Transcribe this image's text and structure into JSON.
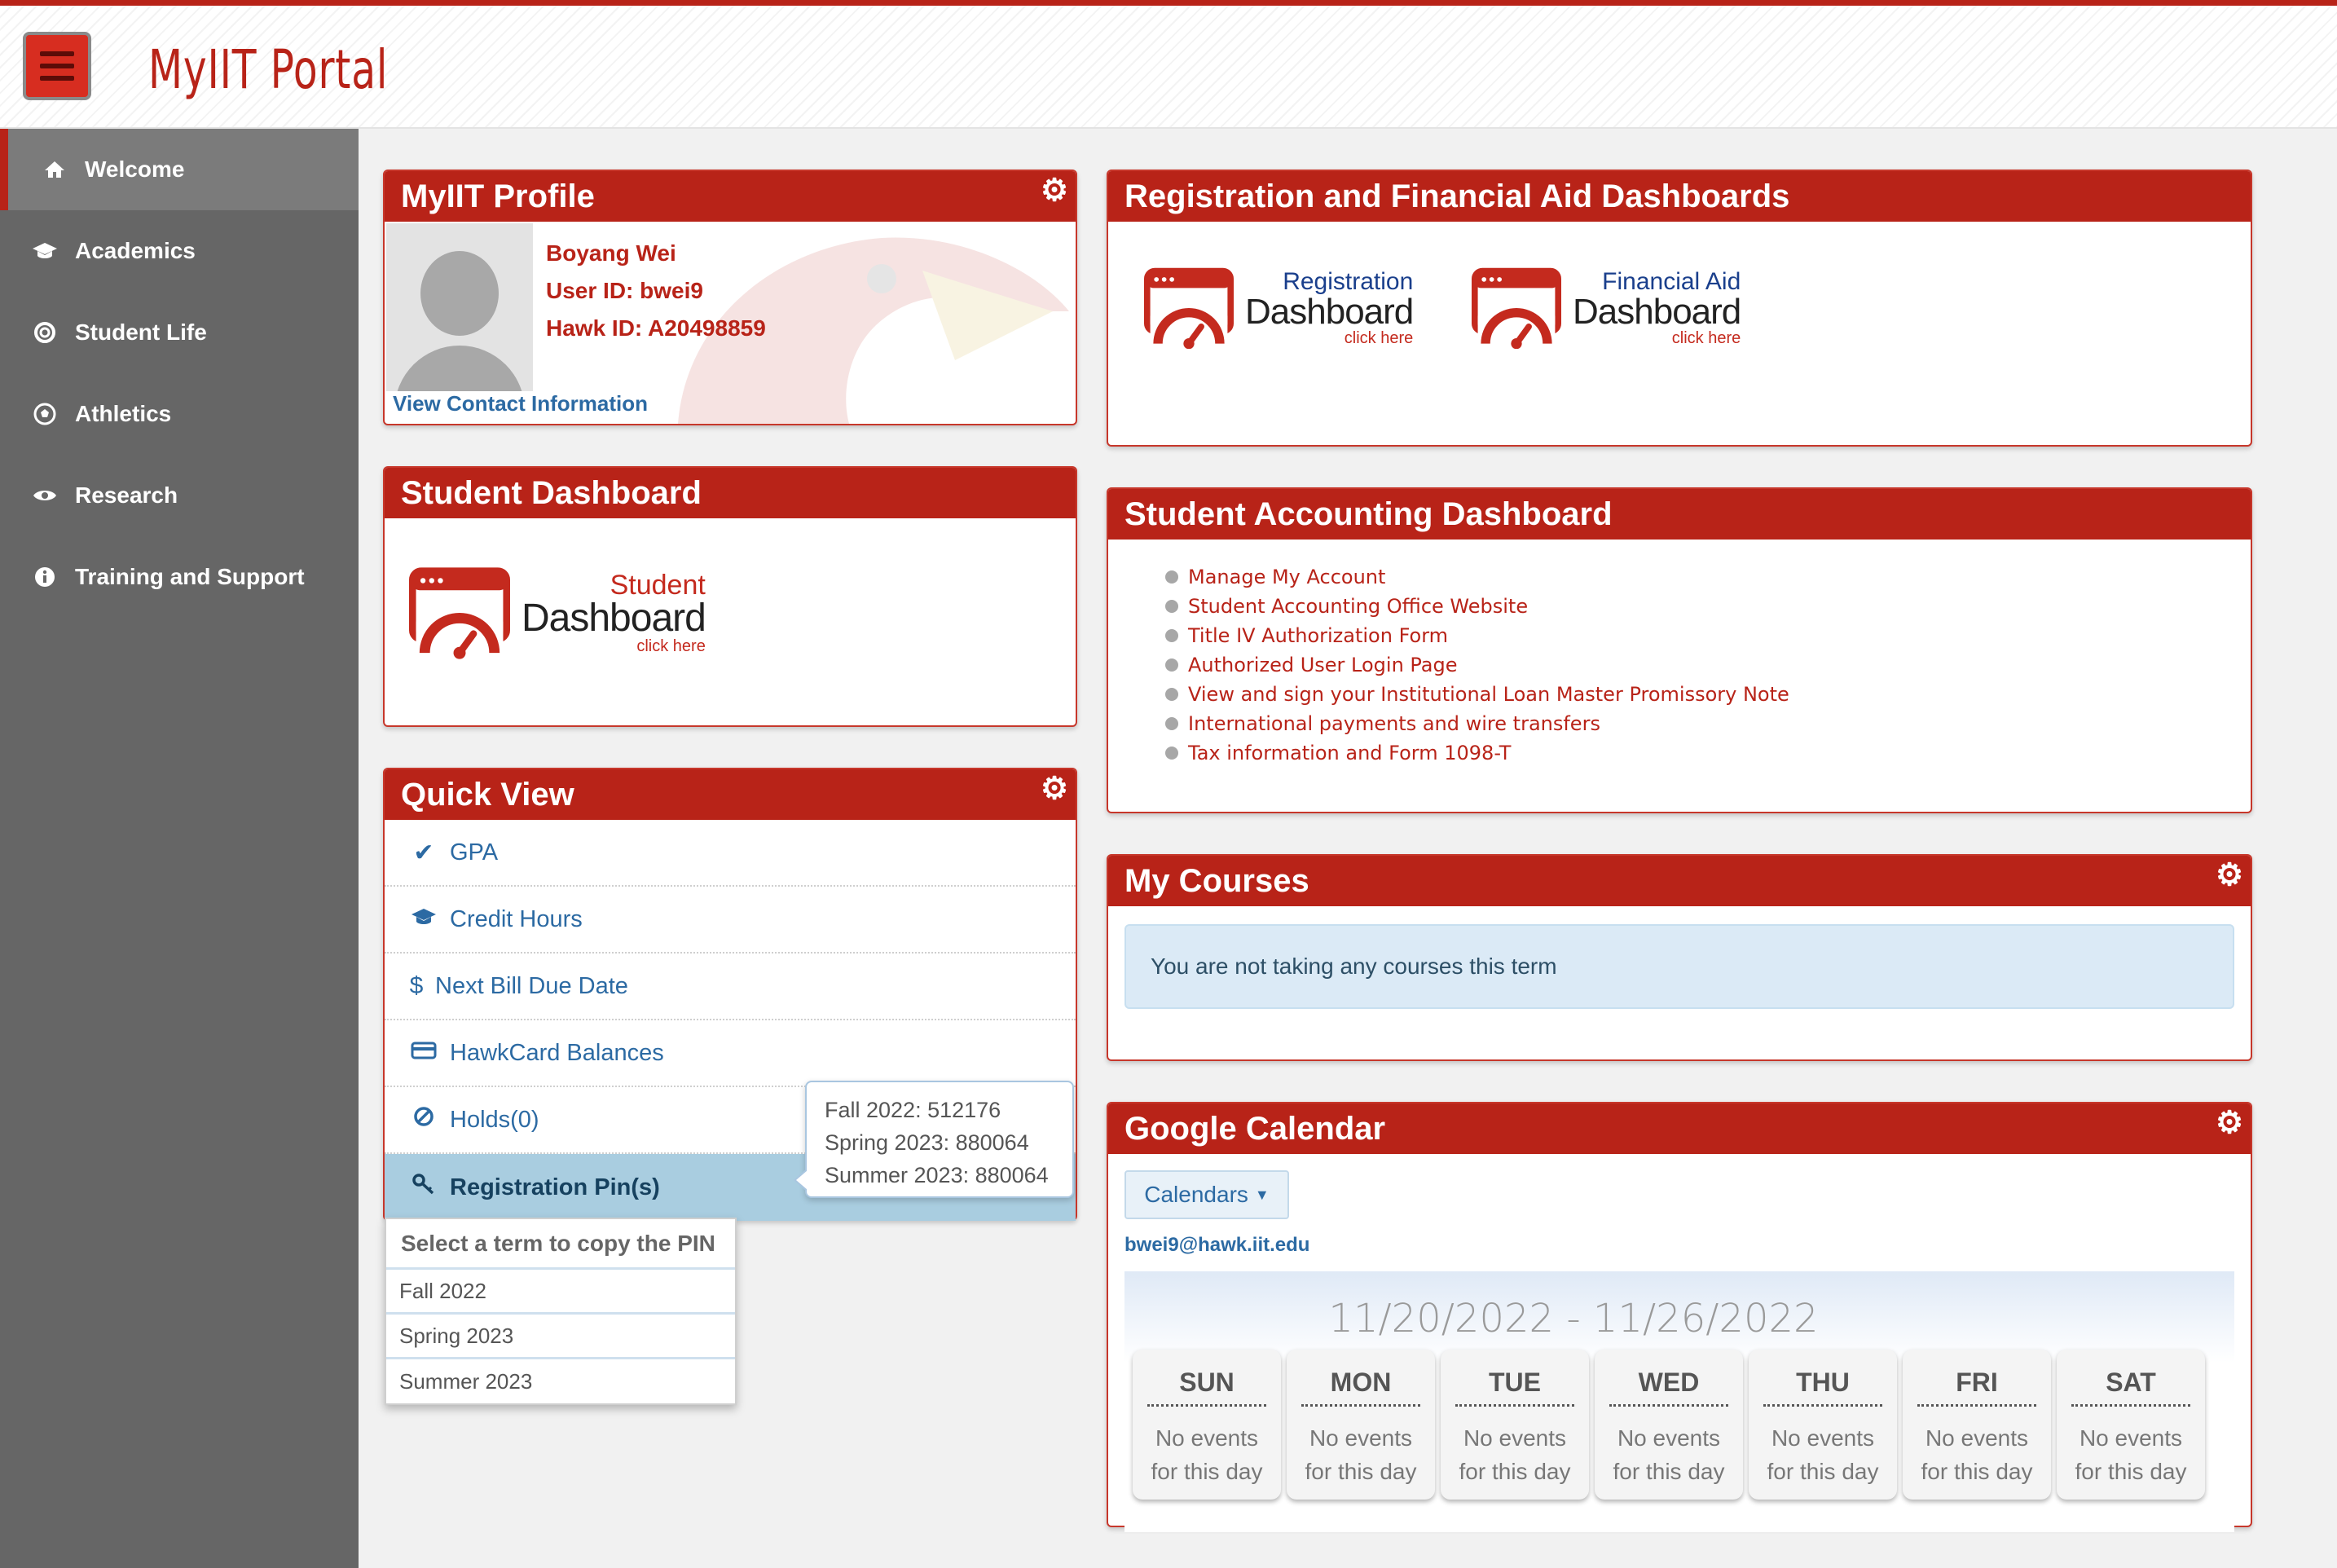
{
  "header": {
    "brand": "MyIIT Portal"
  },
  "sidebar": {
    "items": [
      {
        "label": "Welcome",
        "icon": "home-icon"
      },
      {
        "label": "Academics",
        "icon": "graduation-cap-icon"
      },
      {
        "label": "Student Life",
        "icon": "life-ring-icon"
      },
      {
        "label": "Athletics",
        "icon": "soccer-ball-icon"
      },
      {
        "label": "Research",
        "icon": "eye-icon"
      },
      {
        "label": "Training and Support",
        "icon": "info-icon"
      }
    ]
  },
  "profile": {
    "title": "MyIIT Profile",
    "name": "Boyang Wei",
    "user_id": "User ID: bwei9",
    "hawk_id": "Hawk ID: A20498859",
    "contact_link": "View Contact Information"
  },
  "student_dashboard": {
    "title": "Student Dashboard",
    "logo_top": "Student",
    "logo_main": "Dashboard",
    "logo_sub": "click here"
  },
  "quick_view": {
    "title": "Quick View",
    "items": [
      {
        "label": "GPA",
        "icon": "check-icon"
      },
      {
        "label": "Credit Hours",
        "icon": "graduation-cap-icon"
      },
      {
        "label": "Next Bill Due Date",
        "icon": "dollar-icon"
      },
      {
        "label": "HawkCard Balances",
        "icon": "credit-card-icon"
      },
      {
        "label": "Holds(0)",
        "icon": "ban-icon"
      },
      {
        "label": "Registration Pin(s)",
        "icon": "key-icon"
      }
    ],
    "pins_popover": [
      "Fall 2022: 512176",
      "Spring 2023: 880064",
      "Summer 2023: 880064"
    ],
    "term_menu": {
      "header": "Select a term to copy the PIN",
      "options": [
        "Fall 2022",
        "Spring 2023",
        "Summer 2023"
      ]
    }
  },
  "reg_fin": {
    "title": "Registration and Financial Aid Dashboards",
    "registration": {
      "top": "Registration",
      "main": "Dashboard",
      "sub": "click here"
    },
    "financial": {
      "top": "Financial Aid",
      "main": "Dashboard",
      "sub": "click here"
    }
  },
  "accounting": {
    "title": "Student Accounting Dashboard",
    "links": [
      "Manage My Account",
      "Student Accounting Office Website",
      "Title IV Authorization Form",
      "Authorized User Login Page",
      "View and sign your Institutional Loan Master Promissory Note",
      "International payments and wire transfers",
      "Tax information and Form 1098-T"
    ]
  },
  "courses": {
    "title": "My Courses",
    "message": "You are not taking any courses this term"
  },
  "calendar": {
    "title": "Google Calendar",
    "button": "Calendars",
    "email": "bwei9@hawk.iit.edu",
    "range": "11/20/2022 - 11/26/2022",
    "days": [
      {
        "name": "SUN",
        "note1": "No events",
        "note2": "for this day"
      },
      {
        "name": "MON",
        "note1": "No events",
        "note2": "for this day"
      },
      {
        "name": "TUE",
        "note1": "No events",
        "note2": "for this day"
      },
      {
        "name": "WED",
        "note1": "No events",
        "note2": "for this day"
      },
      {
        "name": "THU",
        "note1": "No events",
        "note2": "for this day"
      },
      {
        "name": "FRI",
        "note1": "No events",
        "note2": "for this day"
      },
      {
        "name": "SAT",
        "note1": "No events",
        "note2": "for this day"
      }
    ]
  },
  "colors": {
    "brand_red": "#b82318",
    "sidebar_gray": "#666666",
    "link_blue": "#2c6aa3"
  }
}
